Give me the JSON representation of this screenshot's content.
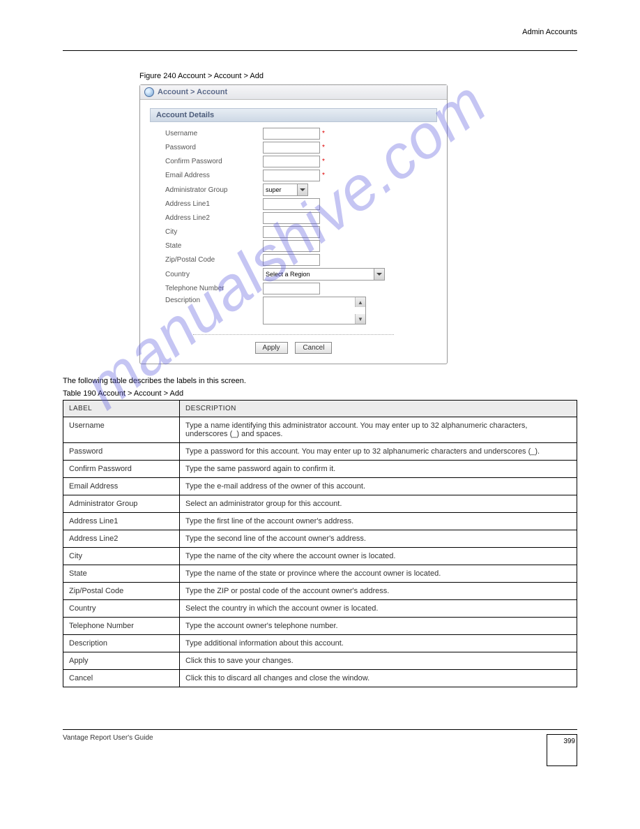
{
  "header": {
    "title": "Admin Accounts"
  },
  "figure": {
    "caption": "Figure 240   Account > Account > Add"
  },
  "watermark": "manualshive.com",
  "screenshot": {
    "breadcrumb": "Account > Account",
    "section_header": "Account Details",
    "fields": {
      "username": "Username",
      "password": "Password",
      "confirm_password": "Confirm Password",
      "email": "Email Address",
      "admin_group": "Administrator Group",
      "admin_group_value": "super",
      "addr1": "Address Line1",
      "addr2": "Address Line2",
      "city": "City",
      "state": "State",
      "zip": "Zip/Postal Code",
      "country": "Country",
      "country_value": "Select a Region",
      "phone": "Telephone Number",
      "description": "Description"
    },
    "buttons": {
      "apply": "Apply",
      "cancel": "Cancel"
    }
  },
  "table_caption": "The following table describes the labels in this screen.",
  "table": {
    "head_label": "LABEL",
    "head_desc": "DESCRIPTION",
    "rows": [
      {
        "label": "Username",
        "desc": "Type a name identifying this administrator account. You may enter up to 32 alphanumeric characters, underscores (_) and spaces."
      },
      {
        "label": "Password",
        "desc": "Type a password for this account. You may enter up to 32 alphanumeric characters and underscores (_)."
      },
      {
        "label": "Confirm Password",
        "desc": "Type the same password again to confirm it."
      },
      {
        "label": "Email Address",
        "desc": "Type the e-mail address of the owner of this account."
      },
      {
        "label": "Administrator Group",
        "desc": "Select an administrator group for this account."
      },
      {
        "label": "Address Line1",
        "desc": "Type the first line of the account owner's address."
      },
      {
        "label": "Address Line2",
        "desc": "Type the second line of the account owner's address."
      },
      {
        "label": "City",
        "desc": "Type the name of the city where the account owner is located."
      },
      {
        "label": "State",
        "desc": "Type the name of the state or province where the account owner is located."
      },
      {
        "label": "Zip/Postal Code",
        "desc": "Type the ZIP or postal code of the account owner's address."
      },
      {
        "label": "Country",
        "desc": "Select the country in which the account owner is located."
      },
      {
        "label": "Telephone Number",
        "desc": "Type the account owner's telephone number."
      },
      {
        "label": "Description",
        "desc": "Type additional information about this account."
      },
      {
        "label": "Apply",
        "desc": "Click this to save your changes."
      },
      {
        "label": "Cancel",
        "desc": "Click this to discard all changes and close the window."
      }
    ]
  },
  "table_title": "Table 190   Account > Account > Add",
  "footer": {
    "text": "Vantage Report User's Guide",
    "page": "399"
  }
}
